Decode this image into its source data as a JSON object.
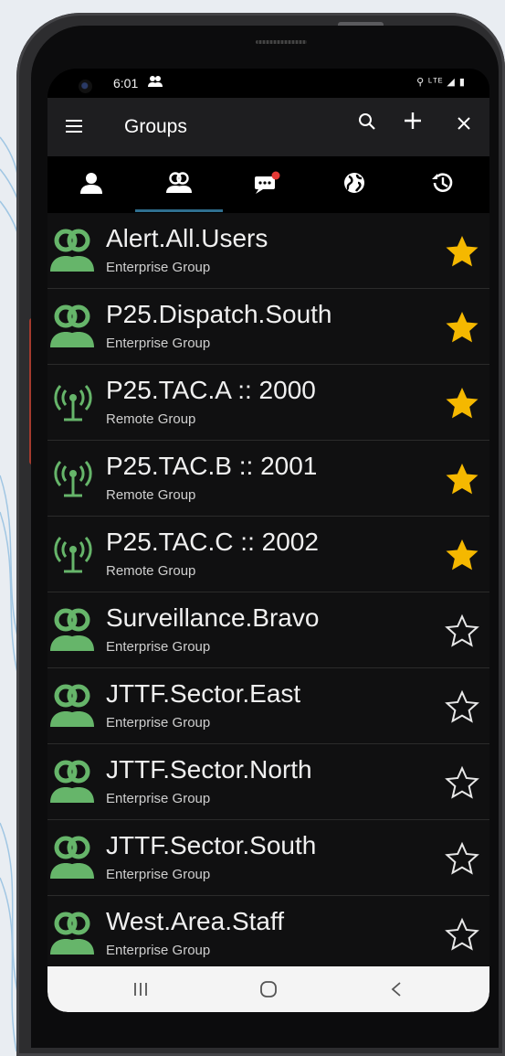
{
  "status_bar": {
    "time": "6:01",
    "indicators": "⚲ ᴸᵀᴱ ◢ ▮"
  },
  "app_bar": {
    "title": "Groups",
    "menu_icon": "menu-icon",
    "search_icon": "search-icon",
    "add_icon": "add-icon",
    "close_icon": "close-icon"
  },
  "tabs": [
    {
      "icon": "person-icon",
      "selected": false
    },
    {
      "icon": "group-icon",
      "selected": true
    },
    {
      "icon": "message-icon",
      "selected": false,
      "badge": true
    },
    {
      "icon": "globe-icon",
      "selected": false
    },
    {
      "icon": "history-icon",
      "selected": false
    }
  ],
  "groups": [
    {
      "name": "Alert.All.Users",
      "type": "Enterprise Group",
      "icon": "group-icon",
      "favorite": true
    },
    {
      "name": "P25.Dispatch.South",
      "type": "Enterprise Group",
      "icon": "group-icon",
      "favorite": true
    },
    {
      "name": "P25.TAC.A :: 2000",
      "type": "Remote Group",
      "icon": "radio-antenna-icon",
      "favorite": true
    },
    {
      "name": "P25.TAC.B :: 2001",
      "type": "Remote Group",
      "icon": "radio-antenna-icon",
      "favorite": true
    },
    {
      "name": "P25.TAC.C :: 2002",
      "type": "Remote Group",
      "icon": "radio-antenna-icon",
      "favorite": true
    },
    {
      "name": "Surveillance.Bravo",
      "type": "Enterprise Group",
      "icon": "group-icon",
      "favorite": false
    },
    {
      "name": "JTTF.Sector.East",
      "type": "Enterprise Group",
      "icon": "group-icon",
      "favorite": false
    },
    {
      "name": "JTTF.Sector.North",
      "type": "Enterprise Group",
      "icon": "group-icon",
      "favorite": false
    },
    {
      "name": "JTTF.Sector.South",
      "type": "Enterprise Group",
      "icon": "group-icon",
      "favorite": false
    },
    {
      "name": "West.Area.Staff",
      "type": "Enterprise Group",
      "icon": "group-icon",
      "favorite": false
    }
  ],
  "nav_bar": {
    "recents_icon": "recents-icon",
    "home_icon": "home-icon",
    "back_icon": "back-icon"
  },
  "colors": {
    "accent_green": "#66b56a",
    "star_gold": "#f5b800",
    "tab_indicator": "#2f6f8f",
    "app_bar": "#1e1e20"
  }
}
